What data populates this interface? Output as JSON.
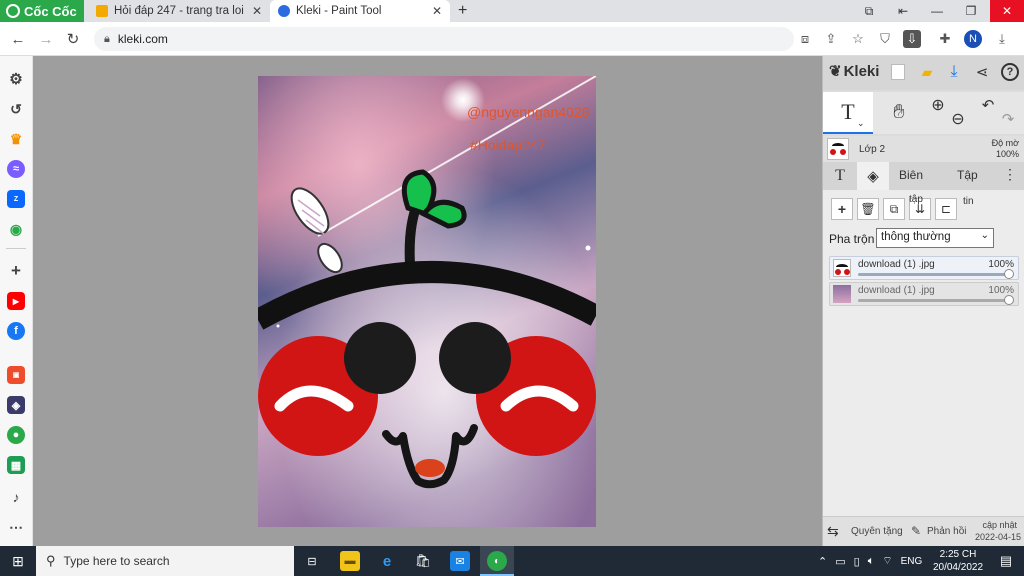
{
  "browser": {
    "brand": "Cốc Cốc",
    "tabs": [
      {
        "title": "Hỏi đáp 247 - trang tra loi",
        "active": false
      },
      {
        "title": "Kleki - Paint Tool",
        "active": true
      }
    ],
    "new_tab": "+",
    "url": "kleki.com",
    "profile_initial": "N"
  },
  "drawing": {
    "watermark_user": "@nguyenngan4028",
    "watermark_tag": "#Hoidap247"
  },
  "kleki": {
    "logo": "Kleki",
    "layer_label": "Lớp 2",
    "opacity_label": "Độ mờ",
    "opacity_value": "100%",
    "tabs": {
      "edit": "Biên",
      "file": "Tập",
      "file2": "tập",
      "file3": "tin"
    },
    "blend_label": "Pha trộn",
    "blend_value": "thông thường",
    "layers": [
      {
        "name": "download (1) .jpg",
        "opacity": "100%",
        "selected": true
      },
      {
        "name": "download (1) .jpg",
        "opacity": "100%",
        "selected": false
      }
    ],
    "footer": {
      "donate": "Quyên tặng",
      "feedback": "Phản hồi",
      "update_label": "cập nhật",
      "update_date": "2022-04-15"
    }
  },
  "taskbar": {
    "search_placeholder": "Type here to search",
    "lang": "ENG",
    "time": "2:25 CH",
    "date": "20/04/2022"
  },
  "colors": {
    "canvas_bg": "#9e9e9e",
    "cheek_red": "#d11414",
    "leaf_green": "#15c04d",
    "watermark": "#e0552b",
    "tab_bar": "#dfe1e5",
    "brand_green": "#2aa84a",
    "taskbar": "#1f2a36"
  }
}
